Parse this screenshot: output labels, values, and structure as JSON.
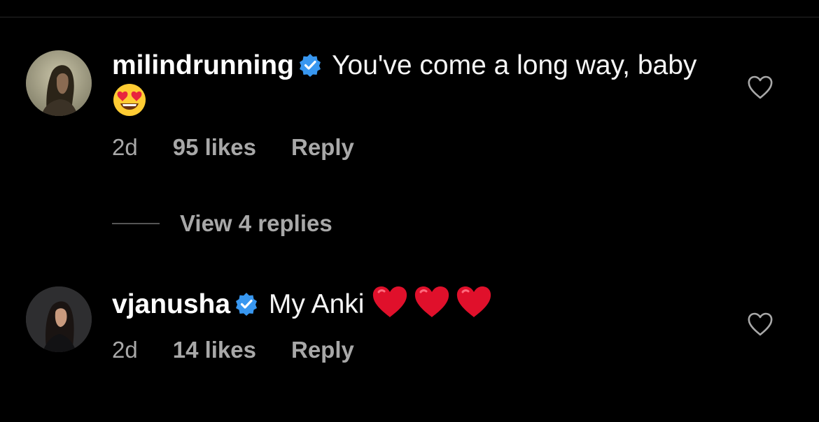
{
  "comments": [
    {
      "username": "milindrunning",
      "verified": true,
      "text": "You've come a long way, baby",
      "emoji": "heart-eyes-emoji",
      "time": "2d",
      "likes": "95 likes",
      "reply": "Reply"
    },
    {
      "username": "vjanusha",
      "verified": true,
      "text": "My Anki",
      "emoji": "red-heart-emoji x3",
      "time": "2d",
      "likes": "14 likes",
      "reply": "Reply"
    }
  ],
  "view_replies": "View 4 replies",
  "colors": {
    "background": "#000000",
    "text": "#f5f5f5",
    "muted": "#a8a8a8",
    "verified_blue": "#3897f0",
    "heart_red": "#e0102b"
  }
}
